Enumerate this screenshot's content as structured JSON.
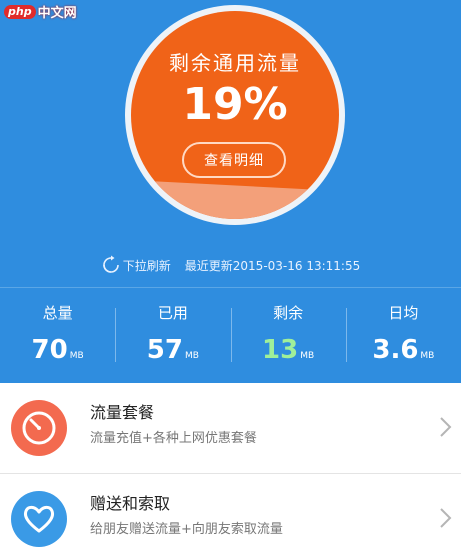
{
  "watermark": {
    "badge": "php",
    "text": "中文网"
  },
  "gauge": {
    "title": "剩余通用流量",
    "percent_text": "19%",
    "remaining_fraction": 0.19,
    "detail_button": "查看明细"
  },
  "refresh": {
    "label": "下拉刷新",
    "last_updated": "最近更新2015-03-16 13:11:55"
  },
  "stats": [
    {
      "label": "总量",
      "value": "70",
      "unit": "MB",
      "color": "#ffffff"
    },
    {
      "label": "已用",
      "value": "57",
      "unit": "MB",
      "color": "#ffffff"
    },
    {
      "label": "剩余",
      "value": "13",
      "unit": "MB",
      "color": "#9ff09a"
    },
    {
      "label": "日均",
      "value": "3.6",
      "unit": "MB",
      "color": "#ffffff"
    }
  ],
  "list": [
    {
      "title": "流量套餐",
      "subtitle": "流量充值+各种上网优惠套餐",
      "icon": "timer-icon",
      "icon_color": "#f36a4f"
    },
    {
      "title": "赠送和索取",
      "subtitle": "给朋友赠送流量+向朋友索取流量",
      "icon": "heart-icon",
      "icon_color": "#3a9ae6"
    }
  ],
  "colors": {
    "header_bg": "#2f8ddf",
    "gauge": "#f06318",
    "gauge_fill": "#f3a07a"
  }
}
